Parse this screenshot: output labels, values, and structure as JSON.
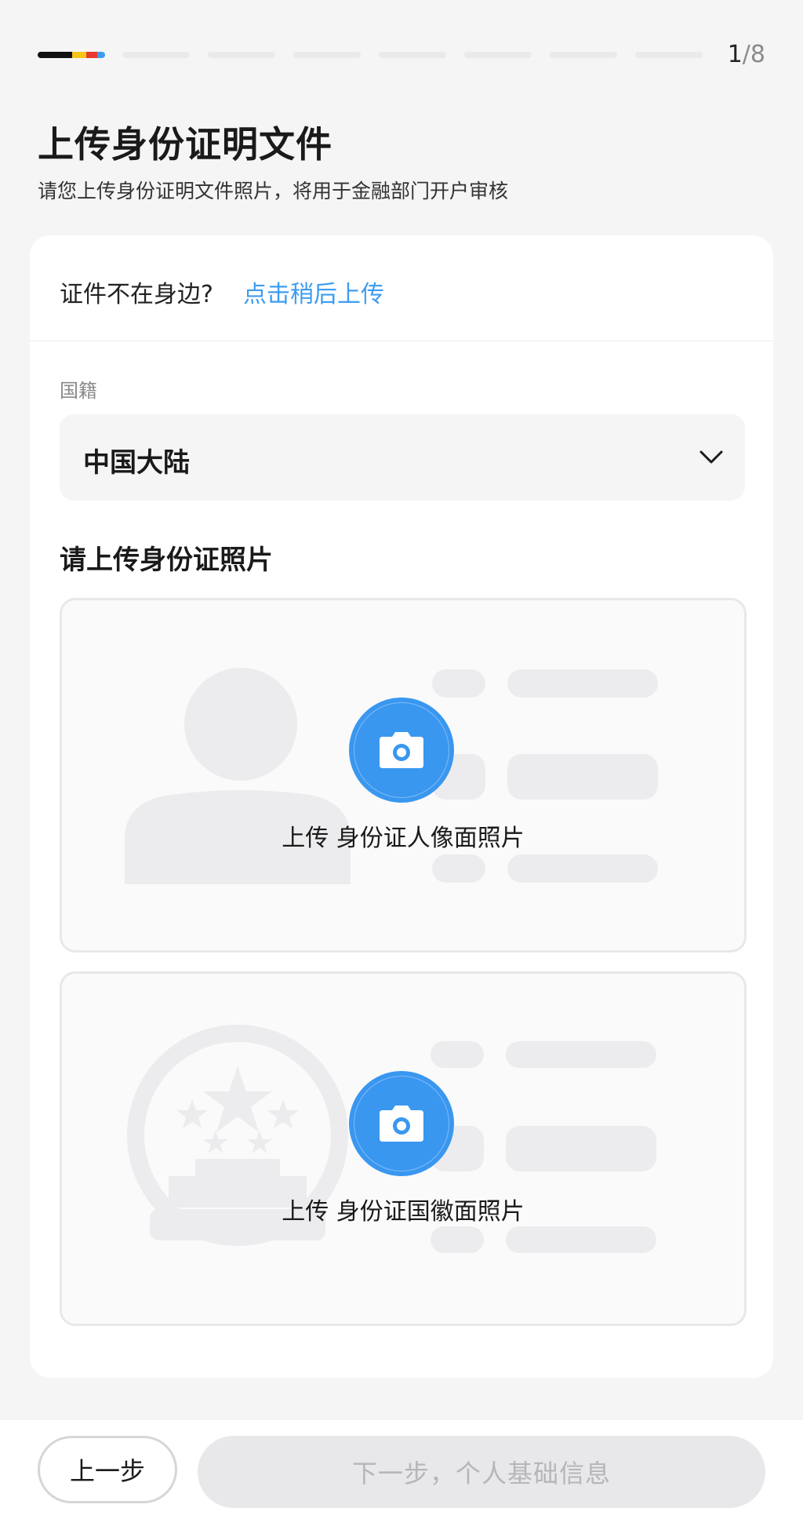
{
  "progress": {
    "current": "1",
    "total": "/8",
    "segments": 8,
    "active_colors": [
      "#111111",
      "#f5c518",
      "#e83a2f",
      "#3e9cf0"
    ]
  },
  "header": {
    "title": "上传身份证明文件",
    "subtitle": "请您上传身份证明文件照片，将用于金融部门开户审核"
  },
  "later": {
    "question": "证件不在身边?",
    "link": "点击稍后上传"
  },
  "nationality": {
    "label": "国籍",
    "value": "中国大陆",
    "icon": "chevron-down-icon"
  },
  "upload": {
    "section_title": "请上传身份证照片",
    "front_label": "上传 身份证人像面照片",
    "back_label": "上传 身份证国徽面照片",
    "icon": "camera-icon",
    "accent": "#3a97f0"
  },
  "footer": {
    "prev_label": "上一步",
    "next_label": "下一步，个人基础信息"
  }
}
